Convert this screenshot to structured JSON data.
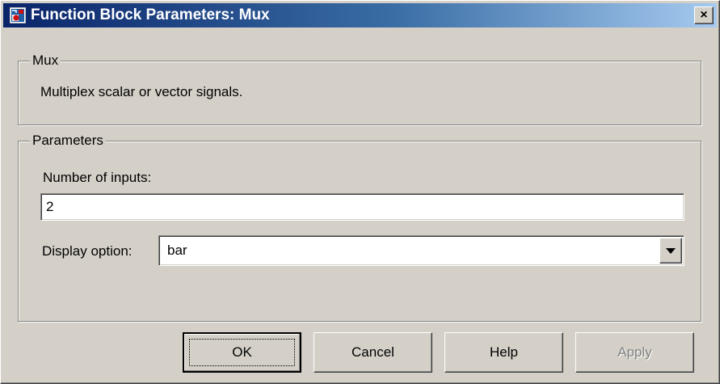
{
  "window": {
    "title": "Function Block Parameters: Mux",
    "close_label": "×"
  },
  "description_group": {
    "title": "Mux",
    "text": "Multiplex scalar or vector signals."
  },
  "parameters_group": {
    "title": "Parameters",
    "number_of_inputs": {
      "label": "Number of inputs:",
      "value": "2"
    },
    "display_option": {
      "label": "Display option:",
      "selected": "bar"
    }
  },
  "buttons": {
    "ok": "OK",
    "cancel": "Cancel",
    "help": "Help",
    "apply": "Apply"
  },
  "icons": {
    "app_icon": "simulink-block-icon",
    "close": "close-icon",
    "dropdown": "chevron-down-icon"
  },
  "colors": {
    "title_bar_start": "#0a246a",
    "title_bar_end": "#a6caf0",
    "dialog_face": "#d4d0c8"
  }
}
